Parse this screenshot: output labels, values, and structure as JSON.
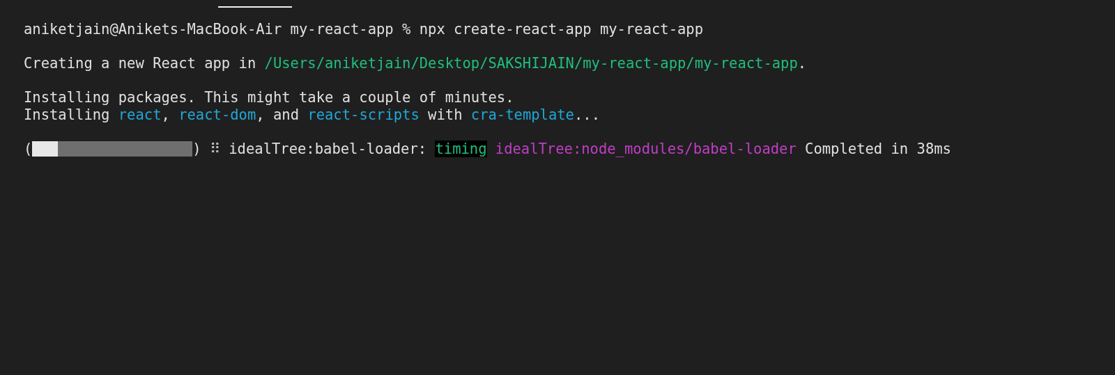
{
  "terminal": {
    "paragraphs": [
      [
        [
          {
            "kind": "plain",
            "text": "aniketjain@Anikets-MacBook-Air my-react-app % npx create-react-app my-react-app"
          }
        ]
      ],
      [
        [
          {
            "kind": "plain",
            "text": "Creating a new React app in "
          },
          {
            "kind": "path",
            "text": "/Users/aniketjain/Desktop/SAKSHIJAIN/my-react-app/my-react-app"
          },
          {
            "kind": "plain",
            "text": "."
          }
        ]
      ],
      [
        [
          {
            "kind": "plain",
            "text": "Installing packages. This might take a couple of minutes."
          }
        ],
        [
          {
            "kind": "plain",
            "text": "Installing "
          },
          {
            "kind": "package",
            "text": "react"
          },
          {
            "kind": "plain",
            "text": ", "
          },
          {
            "kind": "package",
            "text": "react-dom"
          },
          {
            "kind": "plain",
            "text": ", and "
          },
          {
            "kind": "package",
            "text": "react-scripts"
          },
          {
            "kind": "plain",
            "text": " with "
          },
          {
            "kind": "package",
            "text": "cra-template"
          },
          {
            "kind": "plain",
            "text": "..."
          }
        ]
      ],
      [
        [
          {
            "kind": "plain",
            "text": "("
          },
          {
            "kind": "progress",
            "level": 0.16
          },
          {
            "kind": "plain",
            "text": ")"
          },
          {
            "kind": "spinner",
            "text": "⠿"
          },
          {
            "kind": "plain",
            "text": "idealTree:babel-loader:"
          },
          {
            "kind": "badge",
            "text": "timing"
          },
          {
            "kind": "magenta",
            "text": "idealTree:node_modules/babel-loader"
          },
          {
            "kind": "plain",
            "text": "Completed in 38ms"
          }
        ]
      ]
    ]
  }
}
